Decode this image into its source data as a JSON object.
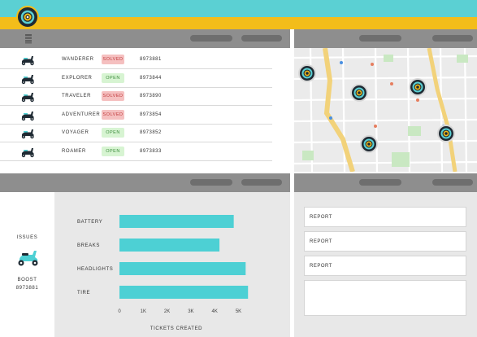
{
  "header": {
    "colors": {
      "teal": "#5bd0d3",
      "yellow": "#f3bd1a"
    },
    "logo_icon": "target-logo-icon"
  },
  "tickets_table": {
    "rows": [
      {
        "name": "WANDERER",
        "status": "SOLVED",
        "status_kind": "solved",
        "ticket": "8973881"
      },
      {
        "name": "EXPLORER",
        "status": "OPEN",
        "status_kind": "open",
        "ticket": "8973844"
      },
      {
        "name": "TRAVELER",
        "status": "SOLVED",
        "status_kind": "solved",
        "ticket": "8973890"
      },
      {
        "name": "ADVENTURER",
        "status": "SOLVED",
        "status_kind": "solved",
        "ticket": "8973854"
      },
      {
        "name": "VOYAGER",
        "status": "OPEN",
        "status_kind": "open",
        "ticket": "8973852"
      },
      {
        "name": "ROAMER",
        "status": "OPEN",
        "status_kind": "open",
        "ticket": "8973833"
      }
    ]
  },
  "issues_panel": {
    "label": "ISSUES",
    "scooter_name": "BOOST",
    "scooter_id": "8973881"
  },
  "chart_data": {
    "type": "bar",
    "orientation": "horizontal",
    "categories": [
      "BATTERY",
      "BREAKS",
      "HEADLIGHTS",
      "TIRE"
    ],
    "values": [
      4.8,
      4.2,
      5.3,
      5.4
    ],
    "xlabel": "TICKETS CREATED",
    "ylabel": "",
    "xlim": [
      0,
      5.5
    ],
    "ticks": [
      "0",
      "1K",
      "2K",
      "3K",
      "4K",
      "5K"
    ],
    "tick_values": [
      0,
      1,
      2,
      3,
      4,
      5
    ],
    "bar_color": "#4dd0d4"
  },
  "reports": [
    {
      "label": "REPORT"
    },
    {
      "label": "REPORT"
    },
    {
      "label": "REPORT"
    },
    {
      "label": ""
    }
  ]
}
